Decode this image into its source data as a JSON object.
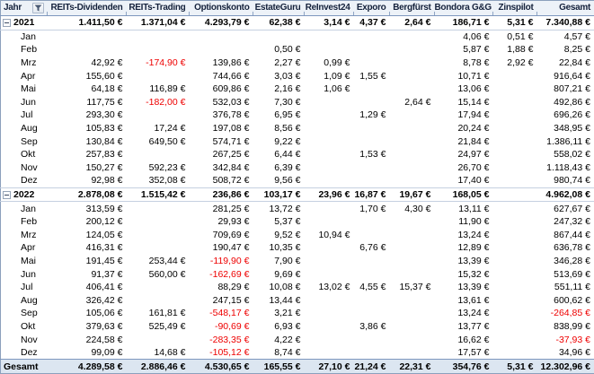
{
  "colors": {
    "negative_value": "#EE0000",
    "grand_total_bg": "#DCE6F1",
    "header_bg": "#EDF2F8",
    "header_border": "#7E97BE",
    "outer_border": "#8CA0BC"
  },
  "icons": {
    "filter": "funnel-filter-icon",
    "collapse": "minus-collapse-icon"
  },
  "table": {
    "row_header_label": "Jahr",
    "columns": [
      "REITs-Dividenden",
      "REITs-Trading",
      "Optionskonto",
      "EstateGuru",
      "ReInvest24",
      "Exporo",
      "Bergfürst",
      "Bondora G&G",
      "Zinspilot",
      "Gesamt"
    ],
    "sections": [
      {
        "year": "2021",
        "totals": [
          "1.411,50 €",
          "1.371,04 €",
          "4.293,79 €",
          "62,38 €",
          "3,14 €",
          "4,37 €",
          "2,64 €",
          "186,71 €",
          "5,31 €",
          "7.340,88 €"
        ],
        "months": [
          {
            "label": "Jan",
            "values": [
              "",
              "",
              "",
              "",
              "",
              "",
              "",
              "4,06 €",
              "0,51 €",
              "4,57 €"
            ]
          },
          {
            "label": "Feb",
            "values": [
              "",
              "",
              "",
              "0,50 €",
              "",
              "",
              "",
              "5,87 €",
              "1,88 €",
              "8,25 €"
            ]
          },
          {
            "label": "Mrz",
            "values": [
              "42,92 €",
              "-174,90 €",
              "139,86 €",
              "2,27 €",
              "0,99 €",
              "",
              "",
              "8,78 €",
              "2,92 €",
              "22,84 €"
            ]
          },
          {
            "label": "Apr",
            "values": [
              "155,60 €",
              "",
              "744,66 €",
              "3,03 €",
              "1,09 €",
              "1,55 €",
              "",
              "10,71 €",
              "",
              "916,64 €"
            ]
          },
          {
            "label": "Mai",
            "values": [
              "64,18 €",
              "116,89 €",
              "609,86 €",
              "2,16 €",
              "1,06 €",
              "",
              "",
              "13,06 €",
              "",
              "807,21 €"
            ]
          },
          {
            "label": "Jun",
            "values": [
              "117,75 €",
              "-182,00 €",
              "532,03 €",
              "7,30 €",
              "",
              "",
              "2,64 €",
              "15,14 €",
              "",
              "492,86 €"
            ]
          },
          {
            "label": "Jul",
            "values": [
              "293,30 €",
              "",
              "376,78 €",
              "6,95 €",
              "",
              "1,29 €",
              "",
              "17,94 €",
              "",
              "696,26 €"
            ]
          },
          {
            "label": "Aug",
            "values": [
              "105,83 €",
              "17,24 €",
              "197,08 €",
              "8,56 €",
              "",
              "",
              "",
              "20,24 €",
              "",
              "348,95 €"
            ]
          },
          {
            "label": "Sep",
            "values": [
              "130,84 €",
              "649,50 €",
              "574,71 €",
              "9,22 €",
              "",
              "",
              "",
              "21,84 €",
              "",
              "1.386,11 €"
            ]
          },
          {
            "label": "Okt",
            "values": [
              "257,83 €",
              "",
              "267,25 €",
              "6,44 €",
              "",
              "1,53 €",
              "",
              "24,97 €",
              "",
              "558,02 €"
            ]
          },
          {
            "label": "Nov",
            "values": [
              "150,27 €",
              "592,23 €",
              "342,84 €",
              "6,39 €",
              "",
              "",
              "",
              "26,70 €",
              "",
              "1.118,43 €"
            ]
          },
          {
            "label": "Dez",
            "values": [
              "92,98 €",
              "352,08 €",
              "508,72 €",
              "9,56 €",
              "",
              "",
              "",
              "17,40 €",
              "",
              "980,74 €"
            ]
          }
        ]
      },
      {
        "year": "2022",
        "totals": [
          "2.878,08 €",
          "1.515,42 €",
          "236,86 €",
          "103,17 €",
          "23,96 €",
          "16,87 €",
          "19,67 €",
          "168,05 €",
          "",
          "4.962,08 €"
        ],
        "months": [
          {
            "label": "Jan",
            "values": [
              "313,59 €",
              "",
              "281,25 €",
              "13,72 €",
              "",
              "1,70 €",
              "4,30 €",
              "13,11 €",
              "",
              "627,67 €"
            ]
          },
          {
            "label": "Feb",
            "values": [
              "200,12 €",
              "",
              "29,93 €",
              "5,37 €",
              "",
              "",
              "",
              "11,90 €",
              "",
              "247,32 €"
            ]
          },
          {
            "label": "Mrz",
            "values": [
              "124,05 €",
              "",
              "709,69 €",
              "9,52 €",
              "10,94 €",
              "",
              "",
              "13,24 €",
              "",
              "867,44 €"
            ]
          },
          {
            "label": "Apr",
            "values": [
              "416,31 €",
              "",
              "190,47 €",
              "10,35 €",
              "",
              "6,76 €",
              "",
              "12,89 €",
              "",
              "636,78 €"
            ]
          },
          {
            "label": "Mai",
            "values": [
              "191,45 €",
              "253,44 €",
              "-119,90 €",
              "7,90 €",
              "",
              "",
              "",
              "13,39 €",
              "",
              "346,28 €"
            ]
          },
          {
            "label": "Jun",
            "values": [
              "91,37 €",
              "560,00 €",
              "-162,69 €",
              "9,69 €",
              "",
              "",
              "",
              "15,32 €",
              "",
              "513,69 €"
            ]
          },
          {
            "label": "Jul",
            "values": [
              "406,41 €",
              "",
              "88,29 €",
              "10,08 €",
              "13,02 €",
              "4,55 €",
              "15,37 €",
              "13,39 €",
              "",
              "551,11 €"
            ]
          },
          {
            "label": "Aug",
            "values": [
              "326,42 €",
              "",
              "247,15 €",
              "13,44 €",
              "",
              "",
              "",
              "13,61 €",
              "",
              "600,62 €"
            ]
          },
          {
            "label": "Sep",
            "values": [
              "105,06 €",
              "161,81 €",
              "-548,17 €",
              "3,21 €",
              "",
              "",
              "",
              "13,24 €",
              "",
              "-264,85 €"
            ]
          },
          {
            "label": "Okt",
            "values": [
              "379,63 €",
              "525,49 €",
              "-90,69 €",
              "6,93 €",
              "",
              "3,86 €",
              "",
              "13,77 €",
              "",
              "838,99 €"
            ]
          },
          {
            "label": "Nov",
            "values": [
              "224,58 €",
              "",
              "-283,35 €",
              "4,22 €",
              "",
              "",
              "",
              "16,62 €",
              "",
              "-37,93 €"
            ]
          },
          {
            "label": "Dez",
            "values": [
              "99,09 €",
              "14,68 €",
              "-105,12 €",
              "8,74 €",
              "",
              "",
              "",
              "17,57 €",
              "",
              "34,96 €"
            ]
          }
        ]
      }
    ],
    "grand_total": {
      "label": "Gesamt",
      "values": [
        "4.289,58 €",
        "2.886,46 €",
        "4.530,65 €",
        "165,55 €",
        "27,10 €",
        "21,24 €",
        "22,31 €",
        "354,76 €",
        "5,31 €",
        "12.302,96 €"
      ]
    }
  }
}
